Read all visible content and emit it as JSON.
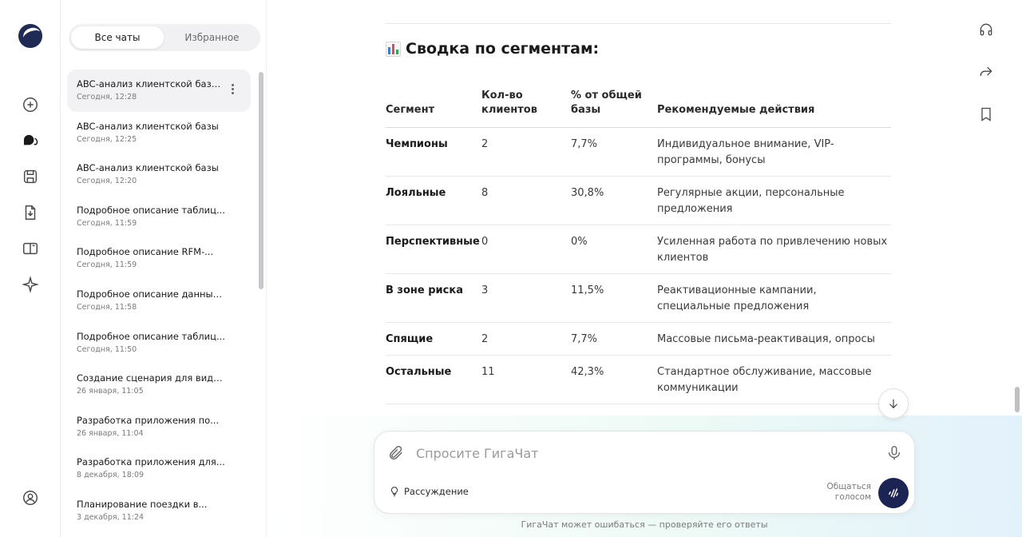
{
  "tabs": {
    "all": "Все чаты",
    "favorites": "Избранное"
  },
  "chats": [
    {
      "title": "ABC-анализ клиентской базы...",
      "date": "Сегодня, 12:28"
    },
    {
      "title": "ABC-анализ клиентской базы",
      "date": "Сегодня, 12:25"
    },
    {
      "title": "ABC-анализ клиентской базы",
      "date": "Сегодня, 12:20"
    },
    {
      "title": "Подробное описание таблиц...",
      "date": "Сегодня, 11:59"
    },
    {
      "title": "Подробное описание RFM-...",
      "date": "Сегодня, 11:59"
    },
    {
      "title": "Подробное описание данных...",
      "date": "Сегодня, 11:58"
    },
    {
      "title": "Подробное описание таблиц...",
      "date": "Сегодня, 11:50"
    },
    {
      "title": "Создание сценария для виде...",
      "date": "26 января, 11:05"
    },
    {
      "title": "Разработка приложения по...",
      "date": "26 января, 11:04"
    },
    {
      "title": "Разработка приложения для...",
      "date": "8 декабря, 18:09"
    },
    {
      "title": "Планирование поездки в...",
      "date": "3 декабря, 11:24"
    }
  ],
  "main": {
    "heading": "Сводка по сегментам:",
    "table": {
      "headers": [
        "Сегмент",
        "Кол-во клиентов",
        "% от общей базы",
        "Рекомендуемые действия"
      ],
      "rows": [
        [
          "Чемпионы",
          "2",
          "7,7%",
          "Индивидуальное внимание, VIP-программы, бонусы"
        ],
        [
          "Лояльные",
          "8",
          "30,8%",
          "Регулярные акции, персональные предложения"
        ],
        [
          "Перспективные",
          "0",
          "0%",
          "Усиленная работа по привлечению новых клиентов"
        ],
        [
          "В зоне риска",
          "3",
          "11,5%",
          "Реактивационные кампании, специальные предложения"
        ],
        [
          "Спящие",
          "2",
          "7,7%",
          "Массовые письма-реактивация, опросы"
        ],
        [
          "Остальные",
          "11",
          "42,3%",
          "Стандартное обслуживание, массовые коммуникации"
        ]
      ]
    }
  },
  "composer": {
    "placeholder": "Спросите ГигаЧат",
    "reasoning_label": "Рассуждение",
    "voice_label": "Общаться голосом"
  },
  "disclaimer": "ГигаЧат может ошибаться — проверяйте его ответы",
  "colors": {
    "accent": "#1b2452",
    "selected_item": "#f2f2f4"
  }
}
